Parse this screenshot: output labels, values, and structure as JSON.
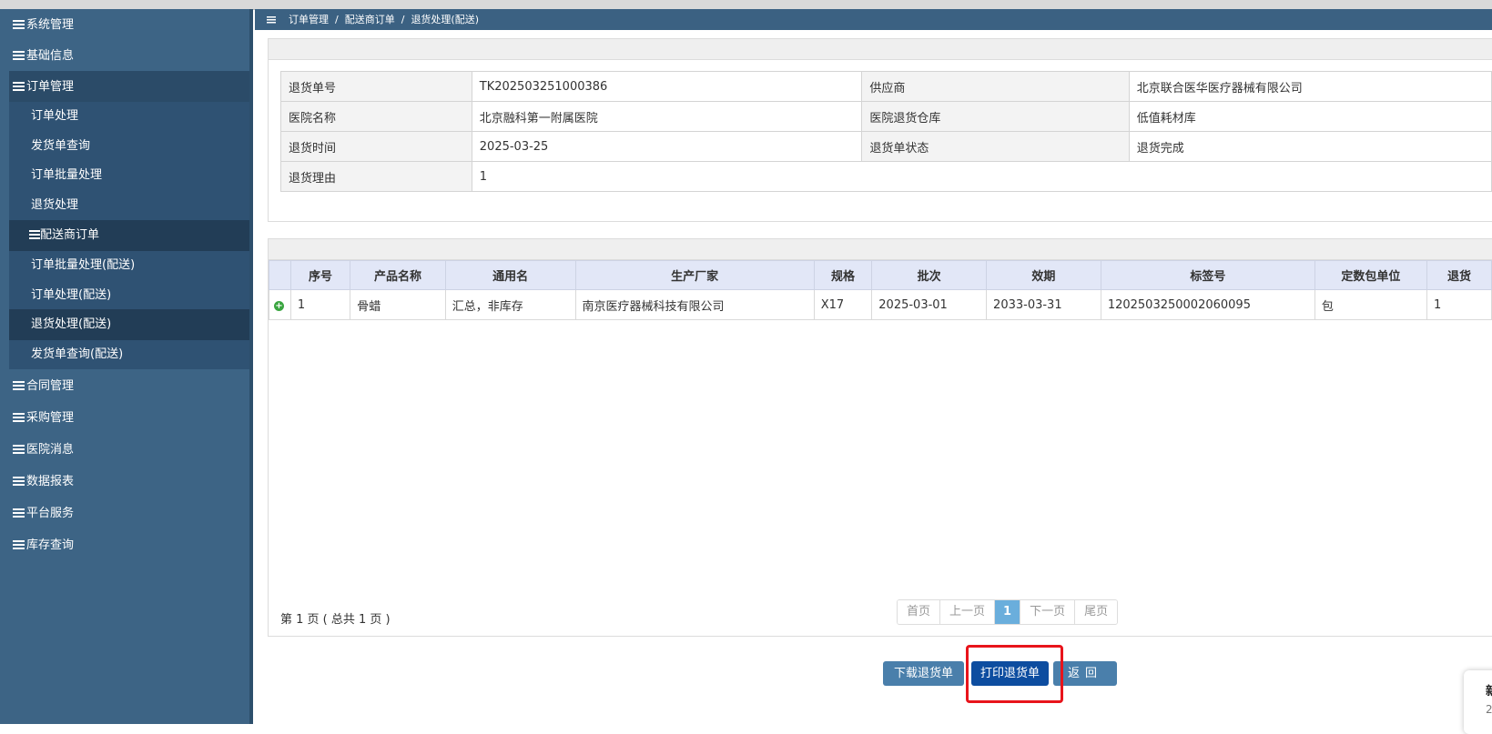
{
  "breadcrumb": [
    "订单管理",
    "配送商订单",
    "退货处理(配送)"
  ],
  "breadcrumb_sep": "/",
  "sidebar": {
    "groups_top": [
      "系统管理",
      "基础信息",
      "订单管理"
    ],
    "order_sub": [
      "订单处理",
      "发货单查询",
      "订单批量处理",
      "退货处理"
    ],
    "distributor_head": "配送商订单",
    "distributor_sub": [
      "订单批量处理(配送)",
      "订单处理(配送)",
      "退货处理(配送)",
      "发货单查询(配送)"
    ],
    "groups_bottom": [
      "合同管理",
      "采购管理",
      "医院消息",
      "数据报表",
      "平台服务",
      "库存查询"
    ]
  },
  "info": {
    "return_no_label": "退货单号",
    "return_no": "TK202503251000386",
    "supplier_label": "供应商",
    "supplier": "北京联合医华医疗器械有限公司",
    "hospital_label": "医院名称",
    "hospital": "北京融科第一附属医院",
    "warehouse_label": "医院退货仓库",
    "warehouse": "低值耗材库",
    "time_label": "退货时间",
    "time": "2025-03-25",
    "status_label": "退货单状态",
    "status": "退货完成",
    "reason_label": "退货理由",
    "reason": "1"
  },
  "table": {
    "headers": [
      "序号",
      "产品名称",
      "通用名",
      "生产厂家",
      "规格",
      "批次",
      "效期",
      "标签号",
      "定数包单位",
      "退货"
    ],
    "rows": [
      [
        "1",
        "骨蜡",
        "汇总，非库存",
        "南京医疗器械科技有限公司",
        "X17",
        "2025-03-01",
        "2033-03-31",
        "1202503250002060095",
        "包",
        "1"
      ]
    ]
  },
  "pagination": {
    "info": "第 1 页 ( 总共 1 页 )",
    "first": "首页",
    "prev": "上一页",
    "current": "1",
    "next": "下一页",
    "last": "尾页"
  },
  "buttons": {
    "download": "下载退货单",
    "print": "打印退货单",
    "back": "返回"
  },
  "popup": {
    "title": "新",
    "text": "2"
  },
  "colors": {
    "sidebar": "#3d6485",
    "highlight": "#e8141b",
    "print_button": "#0d4da0"
  }
}
